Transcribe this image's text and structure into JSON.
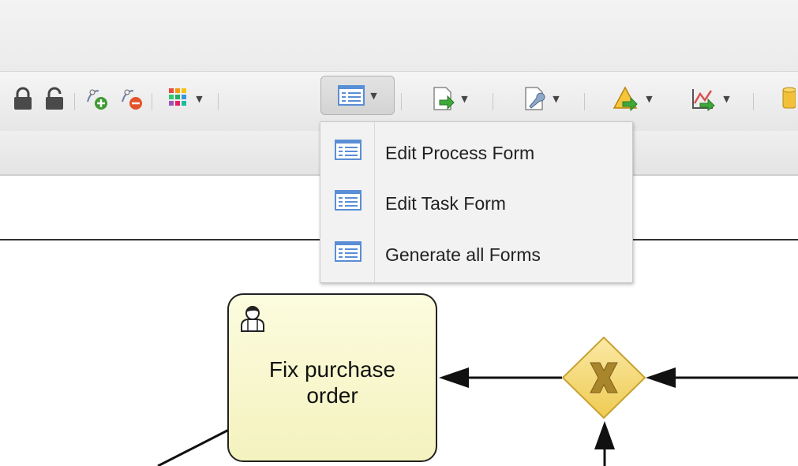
{
  "toolbar": {
    "buttons": [
      {
        "name": "lock-icon"
      },
      {
        "name": "unlock-icon"
      },
      {
        "name": "add-node-icon"
      },
      {
        "name": "remove-node-icon"
      },
      {
        "name": "color-palette-icon",
        "dropdown": true
      },
      {
        "name": "forms-icon",
        "dropdown": true,
        "pressed": true
      },
      {
        "name": "export-document-icon",
        "dropdown": true
      },
      {
        "name": "wrench-icon",
        "dropdown": true
      },
      {
        "name": "validation-warning-icon",
        "dropdown": true
      },
      {
        "name": "simulation-icon",
        "dropdown": true
      },
      {
        "name": "database-icon"
      }
    ]
  },
  "forms_menu": {
    "items": [
      {
        "label": "Edit Process Form",
        "icon": "form-icon"
      },
      {
        "label": "Edit Task Form",
        "icon": "form-icon"
      },
      {
        "label": "Generate all Forms",
        "icon": "form-icon"
      }
    ]
  },
  "diagram": {
    "task": {
      "label_line1": "Fix purchase",
      "label_line2": "order",
      "icon": "user-task-icon"
    },
    "gateway": {
      "type": "exclusive",
      "symbol": "X"
    }
  },
  "colors": {
    "task_fill": "#f7f5c8",
    "gateway_fill": "#f3d66b",
    "form_icon_blue": "#5a8ed6"
  }
}
